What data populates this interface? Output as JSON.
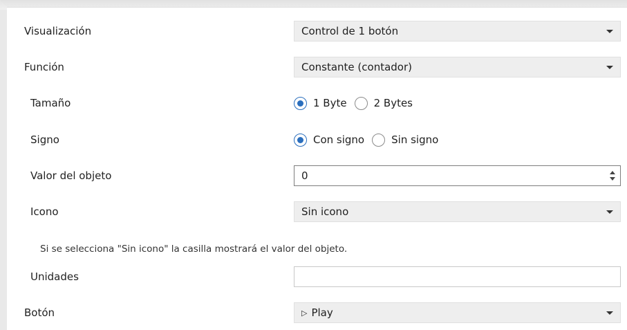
{
  "rows": {
    "visualizacion": {
      "label": "Visualización",
      "value": "Control de 1 botón"
    },
    "funcion": {
      "label": "Función",
      "value": "Constante (contador)"
    },
    "tamano": {
      "label": "Tamaño",
      "options": [
        "1 Byte",
        "2 Bytes"
      ],
      "selected": "1 Byte"
    },
    "signo": {
      "label": "Signo",
      "options": [
        "Con signo",
        "Sin signo"
      ],
      "selected": "Con signo"
    },
    "valor": {
      "label": "Valor del objeto",
      "value": "0"
    },
    "icono": {
      "label": "Icono",
      "value": "Sin icono"
    },
    "note": "Si se selecciona \"Sin icono\" la casilla mostrará el valor del objeto.",
    "unidades": {
      "label": "Unidades",
      "value": ""
    },
    "boton": {
      "label": "Botón",
      "value": "Play",
      "icon": "play-triangle-icon"
    }
  },
  "colors": {
    "radio_accent": "#2a6ebd",
    "dropdown_bg": "#eeeeee"
  }
}
